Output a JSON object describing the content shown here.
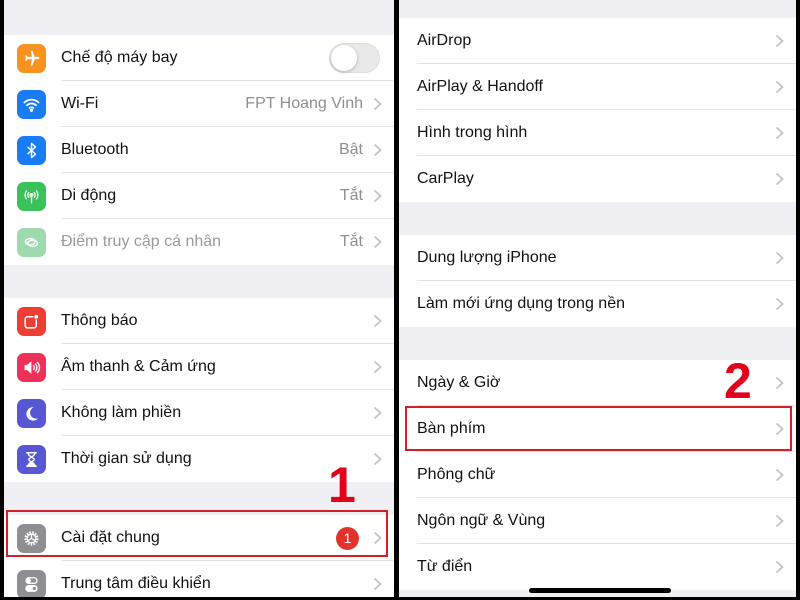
{
  "left_panel": {
    "group1": [
      {
        "label": "Chế độ máy bay",
        "icon": "airplane-icon",
        "color": "#f7931e",
        "control": "toggle",
        "toggle_on": false
      },
      {
        "label": "Wi-Fi",
        "icon": "wifi-icon",
        "color": "#1a7cf5",
        "value": "FPT Hoang Vinh"
      },
      {
        "label": "Bluetooth",
        "icon": "bluetooth-icon",
        "color": "#1a7cf5",
        "value": "Bật"
      },
      {
        "label": "Di động",
        "icon": "cellular-icon",
        "color": "#3ac25a",
        "value": "Tắt"
      },
      {
        "label": "Điểm truy cập cá nhân",
        "icon": "hotspot-icon",
        "color": "#9ddbae",
        "value": "Tắt",
        "disabled": true
      }
    ],
    "group2": [
      {
        "label": "Thông báo",
        "icon": "notifications-icon",
        "color": "#ef3d33"
      },
      {
        "label": "Âm thanh & Cảm ứng",
        "icon": "sound-icon",
        "color": "#f1305a"
      },
      {
        "label": "Không làm phiền",
        "icon": "moon-icon",
        "color": "#5857d3"
      },
      {
        "label": "Thời gian sử dụng",
        "icon": "hourglass-icon",
        "color": "#5857d3"
      }
    ],
    "group3": [
      {
        "label": "Cài đặt chung",
        "icon": "gear-icon",
        "color": "#8e8e93",
        "badge": "1"
      },
      {
        "label": "Trung tâm điều khiển",
        "icon": "control-center-icon",
        "color": "#8e8e93"
      }
    ],
    "step_label": "1"
  },
  "right_panel": {
    "group1": [
      {
        "label": "AirDrop"
      },
      {
        "label": "AirPlay & Handoff"
      },
      {
        "label": "Hình trong hình"
      },
      {
        "label": "CarPlay"
      }
    ],
    "group2": [
      {
        "label": "Dung lượng iPhone"
      },
      {
        "label": "Làm mới ứng dụng trong nền"
      }
    ],
    "group3": [
      {
        "label": "Ngày & Giờ"
      },
      {
        "label": "Bàn phím"
      },
      {
        "label": "Phông chữ"
      },
      {
        "label": "Ngôn ngữ & Vùng"
      },
      {
        "label": "Từ điển"
      }
    ],
    "step_label": "2"
  },
  "colors": {
    "highlight": "#d32027",
    "step_number": "#e3001b",
    "badge": "#e0332b"
  }
}
